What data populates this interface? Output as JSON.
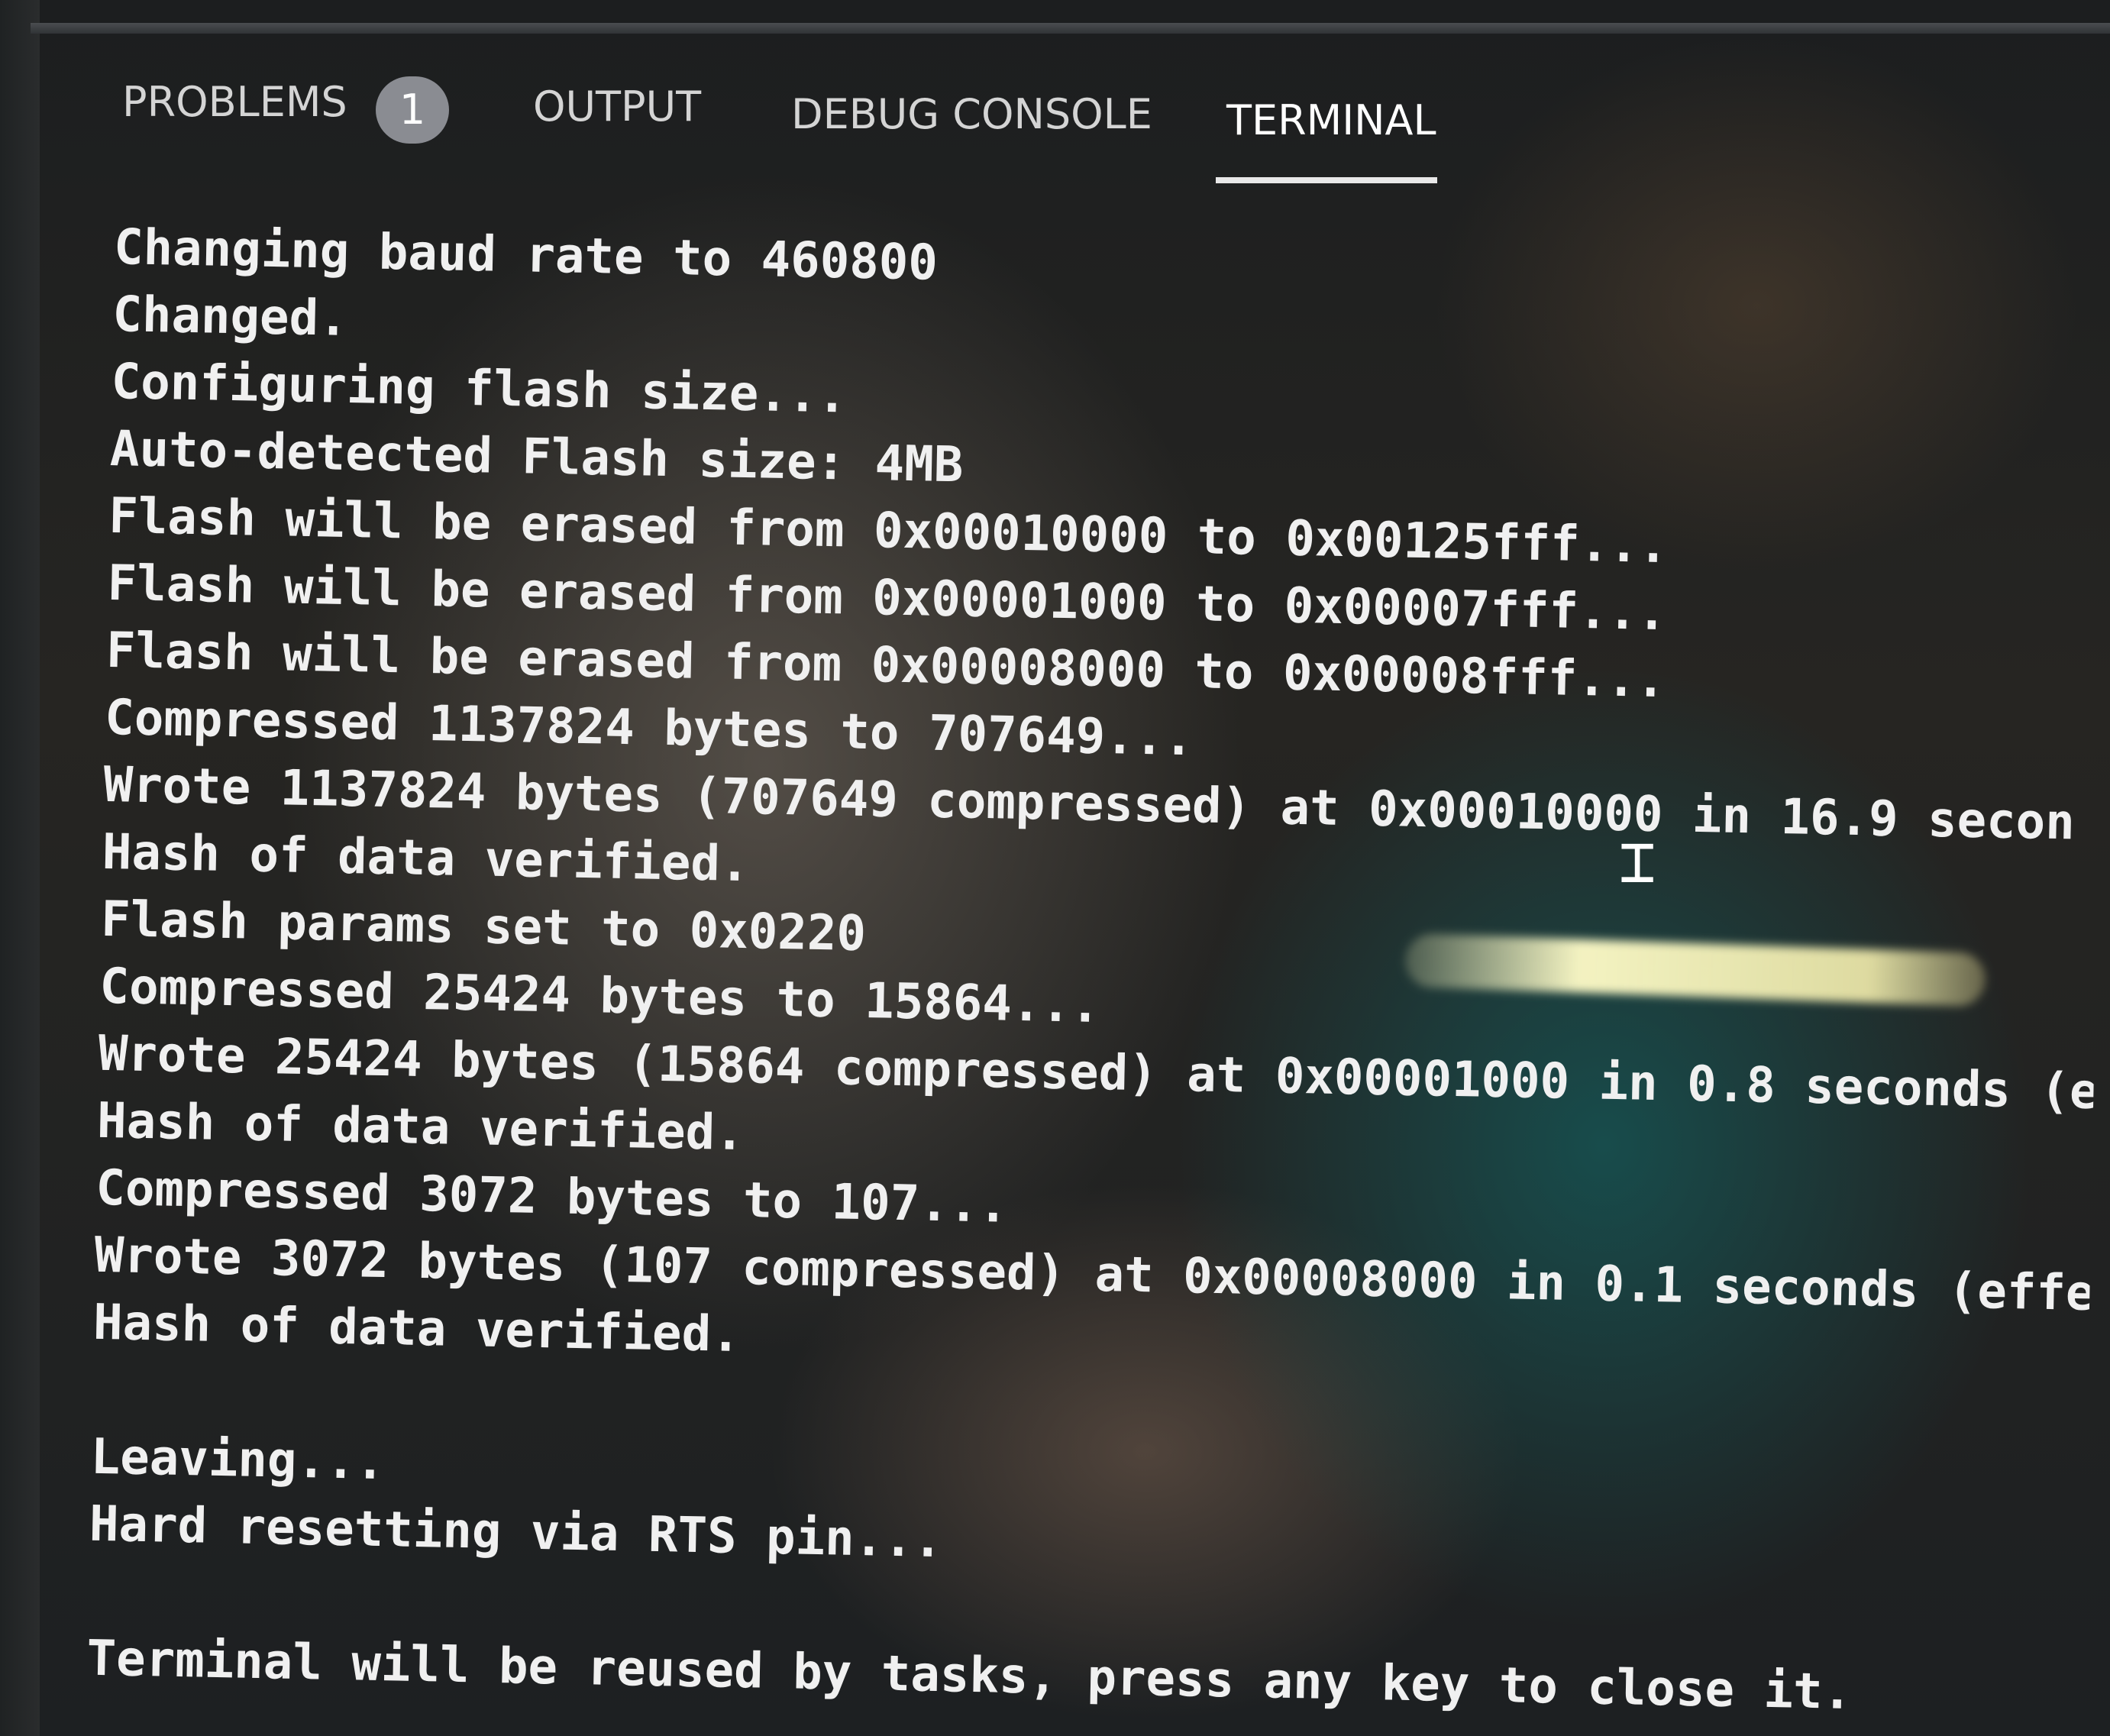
{
  "panel": {
    "tabs": [
      {
        "id": "problems",
        "label": "PROBLEMS"
      },
      {
        "id": "output",
        "label": "OUTPUT"
      },
      {
        "id": "debug",
        "label": "DEBUG CONSOLE"
      },
      {
        "id": "terminal",
        "label": "TERMINAL"
      }
    ],
    "problems_count": "1",
    "active_tab": "terminal"
  },
  "terminal": {
    "lines": [
      "Changing baud rate to 460800",
      "Changed.",
      "Configuring flash size...",
      "Auto-detected Flash size: 4MB",
      "Flash will be erased from 0x00010000 to 0x00125fff...",
      "Flash will be erased from 0x00001000 to 0x00007fff...",
      "Flash will be erased from 0x00008000 to 0x00008fff...",
      "Compressed 1137824 bytes to 707649...",
      "Wrote 1137824 bytes (707649 compressed) at 0x00010000 in 16.9 secon",
      "Hash of data verified.",
      "Flash params set to 0x0220",
      "Compressed 25424 bytes to 15864...",
      "Wrote 25424 bytes (15864 compressed) at 0x00001000 in 0.8 seconds (e",
      "Hash of data verified.",
      "Compressed 3072 bytes to 107...",
      "Wrote 3072 bytes (107 compressed) at 0x00008000 in 0.1 seconds (effe",
      "Hash of data verified.",
      "",
      "Leaving...",
      "Hard resetting via RTS pin...",
      "",
      "Terminal will be reused by tasks, press any key to close it."
    ]
  },
  "icons": {
    "text_cursor": "text-cursor-icon"
  }
}
